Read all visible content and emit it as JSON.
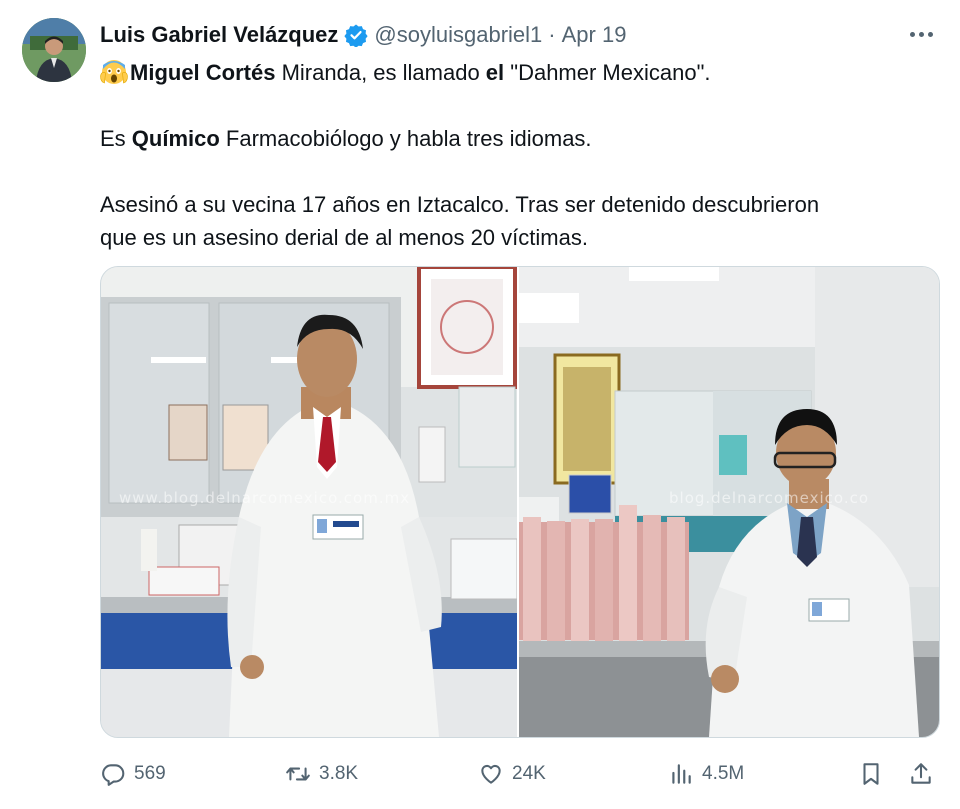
{
  "tweet": {
    "author_name": "Luis Gabriel Velázquez",
    "handle": "@soyluisgabriel1",
    "separator": "·",
    "date": "Apr 19",
    "verified": true,
    "text": {
      "line1_emoji": "scream-emoji",
      "line1_bold_1": "Miguel Cortés",
      "line1_part_2": " Miranda, es llamado ",
      "line1_bold_2": "el",
      "line1_part_3": " \"Dahmer Mexicano\".",
      "line2_part_1": "Es ",
      "line2_bold": "Químico",
      "line2_part_2": " Farmacobiólogo y habla tres idiomas.",
      "line3": "Asesinó a su vecina 17 años en Iztacalco. Tras ser detenido descubrieron",
      "line4": "que es un asesino derial de al menos 20 víctimas."
    },
    "media": {
      "left_watermark": "www.blog.delnarcomexico.com.mx",
      "right_watermark": "blog.delnarcomexico.co"
    },
    "stats": {
      "replies": "569",
      "retweets": "3.8K",
      "likes": "24K",
      "views": "4.5M"
    }
  },
  "colors": {
    "text_primary": "#0f1419",
    "text_secondary": "#536471",
    "verified_blue": "#1d9bf0",
    "border": "#cfd9de"
  },
  "icons": {
    "more": "more-dots-icon",
    "reply": "reply-icon",
    "retweet": "retweet-icon",
    "like": "heart-icon",
    "views": "views-chart-icon",
    "bookmark": "bookmark-icon",
    "share": "share-icon"
  }
}
